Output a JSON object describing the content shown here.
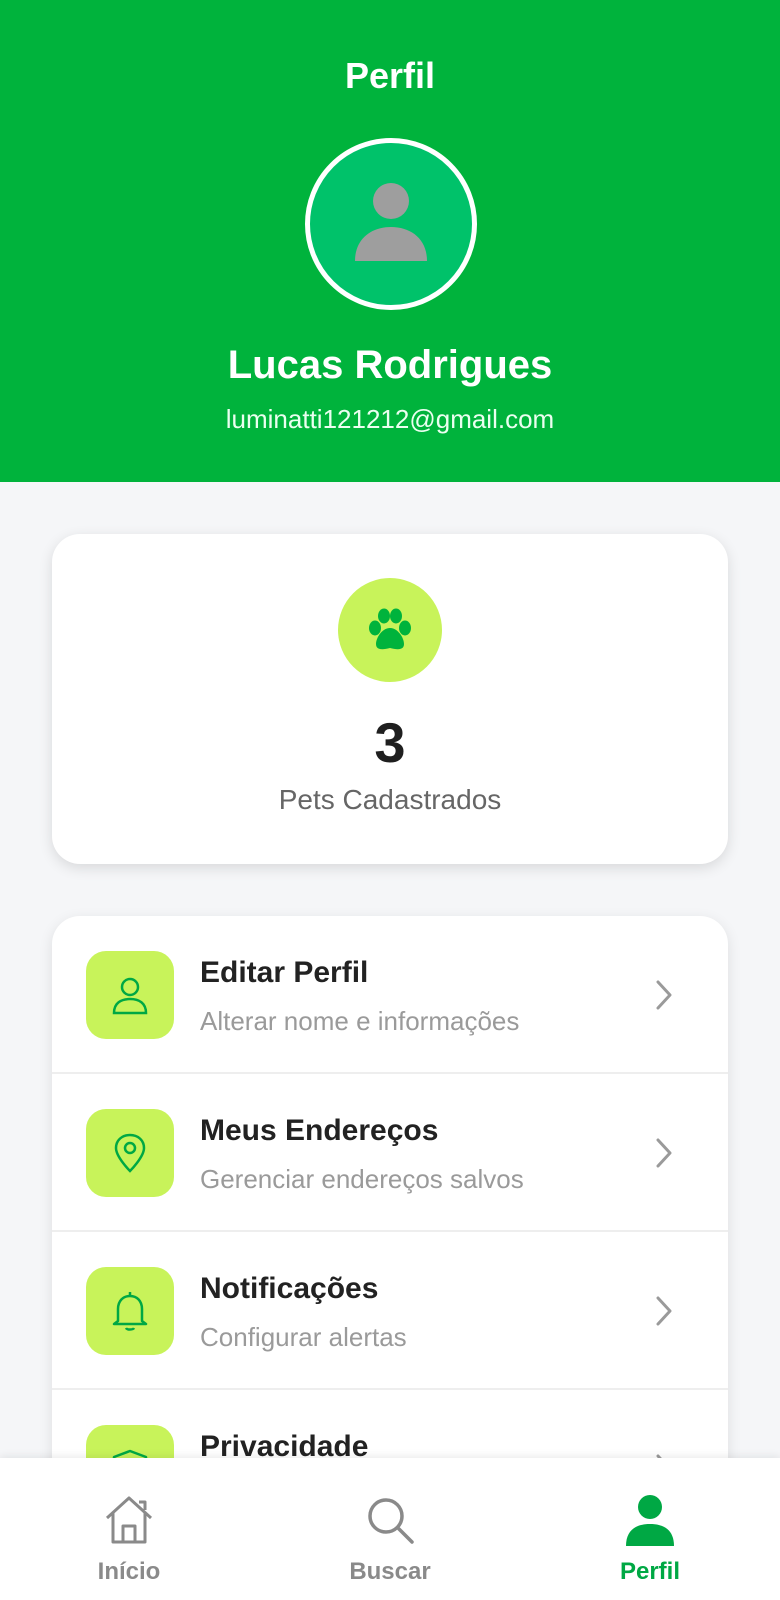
{
  "header": {
    "title": "Perfil",
    "user_name": "Lucas Rodrigues",
    "user_email": "luminatti121212@gmail.com"
  },
  "stats": {
    "pets_count": "3",
    "pets_label": "Pets Cadastrados"
  },
  "menu": {
    "items": [
      {
        "title": "Editar Perfil",
        "subtitle": "Alterar nome e informações",
        "icon": "user-icon"
      },
      {
        "title": "Meus Endereços",
        "subtitle": "Gerenciar endereços salvos",
        "icon": "location-pin-icon"
      },
      {
        "title": "Notificações",
        "subtitle": "Configurar alertas",
        "icon": "bell-icon"
      },
      {
        "title": "Privacidade",
        "subtitle": "",
        "icon": "shield-icon"
      }
    ]
  },
  "bottom_nav": {
    "items": [
      {
        "label": "Início",
        "icon": "home-icon",
        "active": false
      },
      {
        "label": "Buscar",
        "icon": "search-icon",
        "active": false
      },
      {
        "label": "Perfil",
        "icon": "person-icon",
        "active": true
      }
    ]
  },
  "colors": {
    "primary_green": "#00b33c",
    "accent_lime": "#c8f35a",
    "active_nav": "#00a844"
  }
}
